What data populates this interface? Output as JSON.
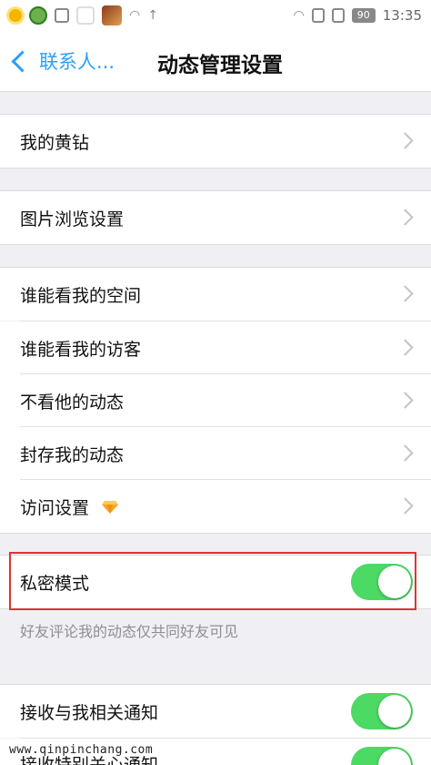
{
  "status_bar": {
    "battery": "90",
    "time": "13:35"
  },
  "nav": {
    "back_label": "联系人...",
    "title": "动态管理设置"
  },
  "groups": {
    "g1": [
      {
        "label": "我的黄钻"
      }
    ],
    "g2": [
      {
        "label": "图片浏览设置"
      }
    ],
    "g3": [
      {
        "label": "谁能看我的空间"
      },
      {
        "label": "谁能看我的访客"
      },
      {
        "label": "不看他的动态"
      },
      {
        "label": "封存我的动态"
      },
      {
        "label": "访问设置"
      }
    ]
  },
  "private_mode": {
    "label": "私密模式",
    "enabled": true,
    "hint": "好友评论我的动态仅共同好友可见"
  },
  "notifications": [
    {
      "label": "接收与我相关通知",
      "enabled": true
    },
    {
      "label": "接收特别关心通知",
      "enabled": true
    }
  ],
  "colors": {
    "accent": "#2aa1f5",
    "toggle_on": "#4cd964",
    "highlight_frame": "#e03232",
    "diamond": "#f5a623"
  },
  "watermark": "www.qinpinchang.com"
}
